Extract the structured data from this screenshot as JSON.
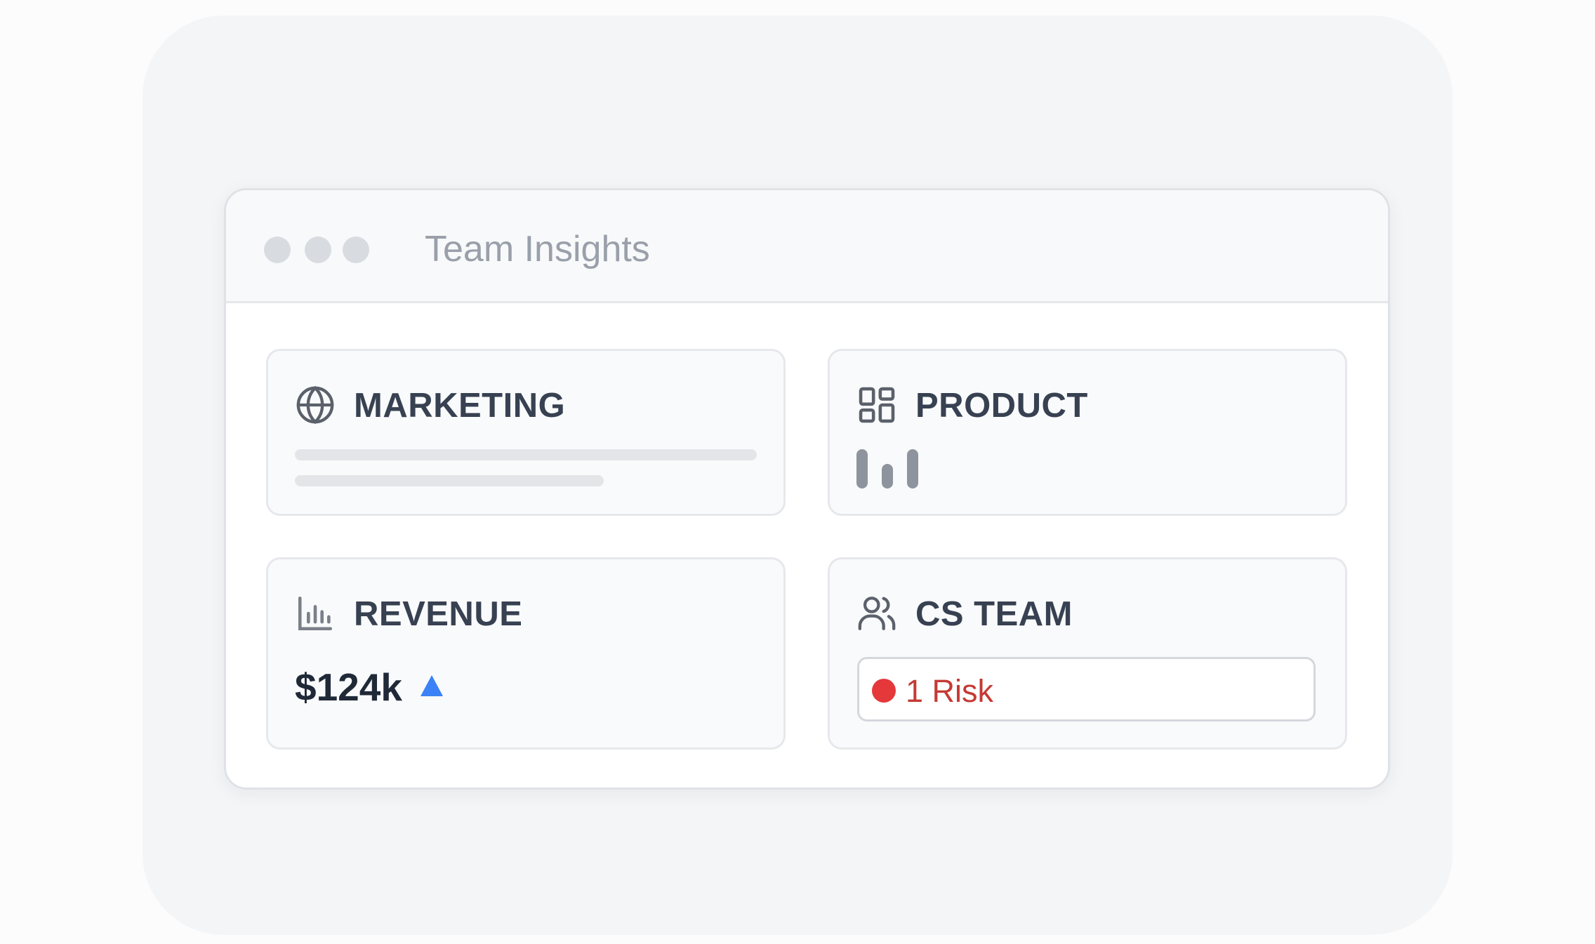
{
  "window": {
    "title": "Team Insights"
  },
  "cards": {
    "marketing": {
      "title": "MARKETING",
      "icon": "globe-icon"
    },
    "product": {
      "title": "PRODUCT",
      "icon": "grid-icon",
      "mini_chart_levels": [
        1.0,
        0.62,
        1.0
      ]
    },
    "revenue": {
      "title": "REVENUE",
      "icon": "bar-chart-icon",
      "value": "$124k",
      "trend": "up",
      "trend_color": "#3b82f6"
    },
    "cs_team": {
      "title": "CS TEAM",
      "icon": "users-icon",
      "risk_label": "1 Risk",
      "risk_color": "#e5383b"
    }
  }
}
